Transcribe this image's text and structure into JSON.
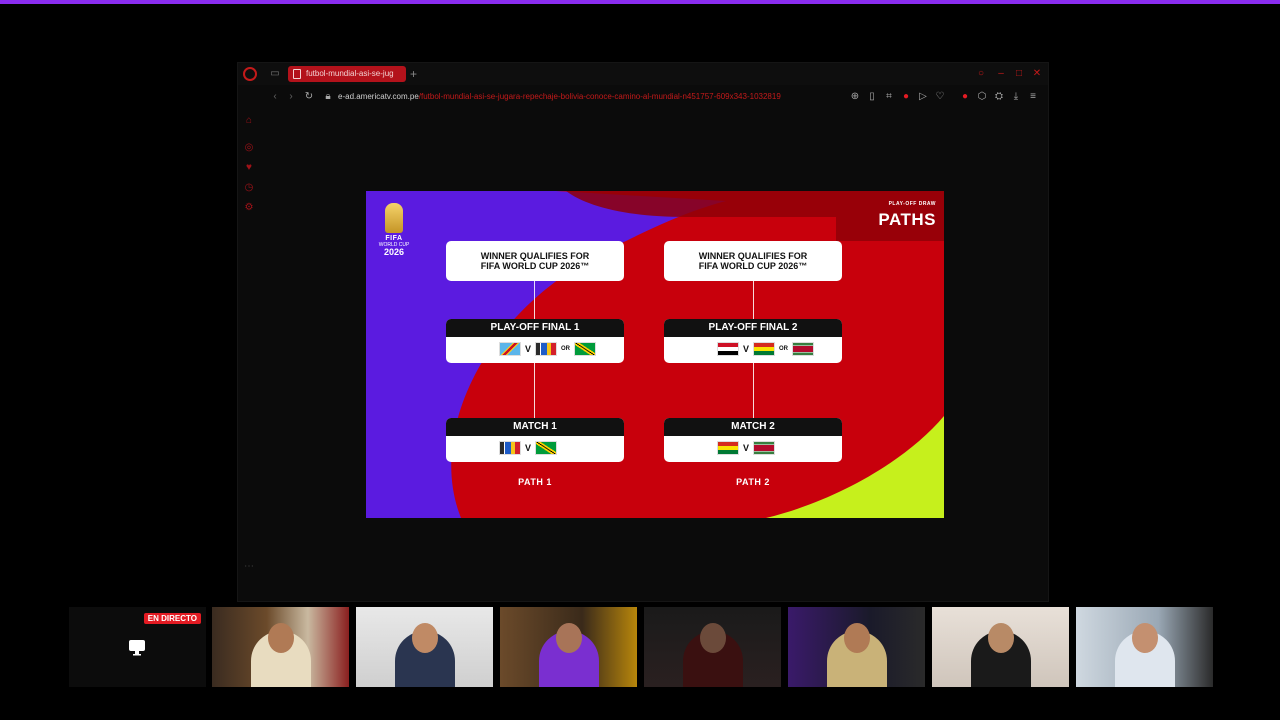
{
  "browser": {
    "tab_title": "futbol-mundial-asi-se-jug",
    "new_tab_symbol": "+",
    "url_host": "e-ad.americatv.com.pe",
    "url_path": "/futbol-mundial-asi-se-jugara-repechaje-bolivia-conoce-camino-al-mundial-n451757-609x343-1032819"
  },
  "graphic": {
    "logo": {
      "fifa": "FIFA",
      "wc": "WORLD CUP",
      "year": "2026"
    },
    "kicker": "PLAY-OFF DRAW",
    "title": "PATHS",
    "winner_text_1": "WINNER QUALIFIES FOR",
    "winner_text_2": "FIFA WORLD CUP 2026™",
    "playoff_final_1": "PLAY-OFF FINAL 1",
    "playoff_final_2": "PLAY-OFF FINAL 2",
    "match_1": "MATCH 1",
    "match_2": "MATCH 2",
    "v": "V",
    "or": "OR",
    "path_1": "PATH 1",
    "path_2": "PATH 2"
  },
  "stream": {
    "live_label": "EN DIRECTO"
  },
  "colors": {
    "accent": "#8a2cf0",
    "browser_red": "#c41a1a",
    "purple": "#5b1be0",
    "red": "#c8000c",
    "lime": "#c6f01c"
  }
}
